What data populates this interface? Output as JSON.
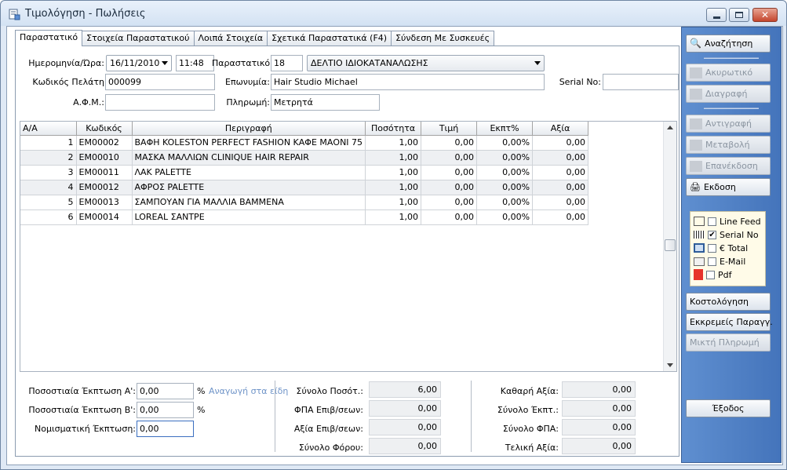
{
  "window": {
    "title": "Τιμολόγηση - Πωλήσεις"
  },
  "tabs": [
    "Παραστατικό",
    "Στοιχεία Παραστατικού",
    "Λοιπά Στοιχεία",
    "Σχετικά Παραστατικά (F4)",
    "Σύνδεση Με Συσκευές"
  ],
  "header": {
    "date_label": "Ημερομηνία/Ώρα:",
    "date": "16/11/2010",
    "time": "11:48",
    "doc_label": "Παραστατικό:",
    "doc_no": "18",
    "doc_type": "ΔΕΛΤΙΟ ΙΔΙΟΚΑΤΑΝΑΛΩΣΗΣ",
    "customer_code_label": "Κωδικός Πελάτη",
    "customer_code": "000099",
    "name_label": "Επωνυμία:",
    "name": "Hair Studio Michael",
    "serial_label": "Serial No:",
    "serial": "",
    "afm_label": "Α.Φ.Μ.:",
    "afm": "",
    "payment_label": "Πληρωμή:",
    "payment": "Μετρητά"
  },
  "table": {
    "columns": [
      "Α/Α",
      "Κωδικός",
      "Περιγραφή",
      "Ποσότητα",
      "Τιμή",
      "Εκπτ%",
      "Αξία"
    ],
    "rows": [
      [
        "1",
        "EM00002",
        "ΒΑΦΗ KOLESTON PERFECT FASHION ΚΑΦΕ ΜΑΟΝΙ 75",
        "1,00",
        "0,00",
        "0,00%",
        "0,00"
      ],
      [
        "2",
        "EM00010",
        "ΜΑΣΚΑ ΜΑΛΛΙΩΝ CLINIQUE HAIR REPAIR",
        "1,00",
        "0,00",
        "0,00%",
        "0,00"
      ],
      [
        "3",
        "EM00011",
        "ΛΑΚ PALETTE",
        "1,00",
        "0,00",
        "0,00%",
        "0,00"
      ],
      [
        "4",
        "EM00012",
        "ΑΦΡΟΣ PALETTE",
        "1,00",
        "0,00",
        "0,00%",
        "0,00"
      ],
      [
        "5",
        "EM00013",
        "ΣΑΜΠΟΥΑΝ ΓΙΑ ΜΑΛΛΙΑ ΒΑΜΜΕΝΑ",
        "1,00",
        "0,00",
        "0,00%",
        "0,00"
      ],
      [
        "6",
        "EM00014",
        "LOREAL ΣΑΝΤΡΕ",
        "1,00",
        "0,00",
        "0,00%",
        "0,00"
      ]
    ]
  },
  "footer": {
    "disc_a_label": "Ποσοστιαία Έκπτωση  Α':",
    "disc_a": "0,00",
    "disc_b_label": "Ποσοστιαία Έκπτωση  Β':",
    "disc_b": "0,00",
    "money_label": "Νομισματική Έκπτωση:",
    "money": "0,00",
    "percent": "%",
    "reduce_link": "Αναγωγή στα είδη",
    "qty_label": "Σύνολο Ποσότ.:",
    "qty": "6,00",
    "vat_charge_label": "ΦΠΑ Επιβ/σεων:",
    "vat_charge": "0,00",
    "val_charge_label": "Αξία Επιβ/σεων:",
    "val_charge": "0,00",
    "tax_label": "Σύνολο Φόρου:",
    "tax": "0,00",
    "net_label": "Καθαρή Αξία:",
    "net": "0,00",
    "disc_total_label": "Σύνολο Έκπτ.:",
    "disc_total": "0,00",
    "vat_total_label": "Σύνολο ΦΠΑ:",
    "vat_total": "0,00",
    "final_label": "Τελική Αξία:",
    "final": "0,00"
  },
  "sidebar": {
    "search": "Αναζήτηση",
    "cancel": "Ακυρωτικό",
    "delete": "Διαγραφή",
    "copy": "Αντιγραφή",
    "modify": "Μεταβολή",
    "reissue": "Επανέκδοση",
    "issue": "Εκδοση",
    "options": [
      {
        "label": "Line Feed",
        "checked": false
      },
      {
        "label": "Serial No",
        "checked": true
      },
      {
        "label": "€ Total",
        "checked": false
      },
      {
        "label": "E-Mail",
        "checked": false
      },
      {
        "label": "Pdf",
        "checked": false
      }
    ],
    "costing": "Κοστολόγηση",
    "pending": "Εκκρεμείς Παραγγ.",
    "mixed": "Μικτή Πληρωμή",
    "exit": "Έξοδος"
  }
}
